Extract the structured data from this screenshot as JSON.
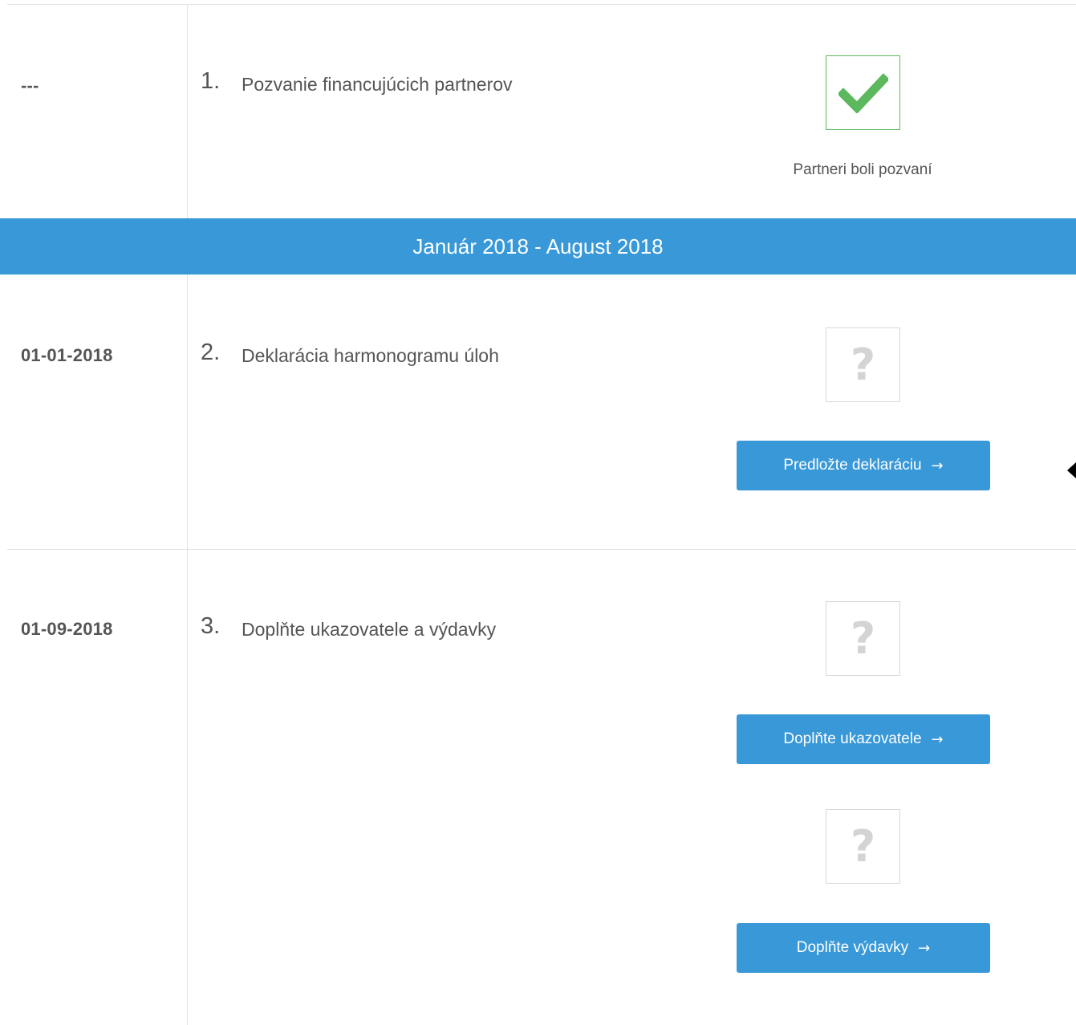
{
  "banner": {
    "label": "Január 2018 - August 2018"
  },
  "steps": [
    {
      "date": "---",
      "number": "1.",
      "title": "Pozvanie financujúcich partnerov",
      "status_icon": "check-icon",
      "status_text": "Partneri boli pozvaní"
    },
    {
      "date": "01-01-2018",
      "number": "2.",
      "title": "Deklarácia harmonogramu úloh",
      "status_icon": "question-icon",
      "status_glyph": "?",
      "action_label": "Predložte deklaráciu",
      "action_arrow": "→"
    },
    {
      "date": "01-09-2018",
      "number": "3.",
      "title": "Doplňte ukazovatele a výdavky",
      "tasks": [
        {
          "status_icon": "question-icon",
          "status_glyph": "?",
          "action_label": "Doplňte ukazovatele",
          "action_arrow": "→"
        },
        {
          "status_icon": "question-icon",
          "status_glyph": "?",
          "action_label": "Doplňte výdavky",
          "action_arrow": "→"
        }
      ]
    }
  ],
  "colors": {
    "primary": "#3898d8",
    "success": "#5cb85c",
    "border": "#e2e2e2",
    "text": "#555555"
  }
}
